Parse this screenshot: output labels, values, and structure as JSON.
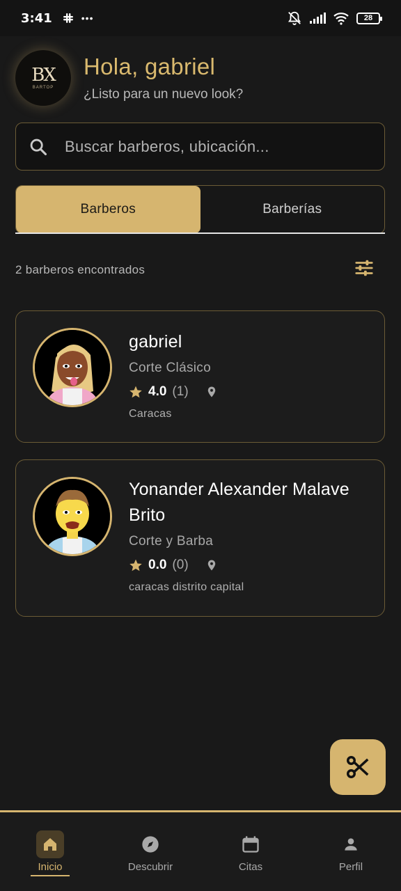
{
  "status_bar": {
    "time": "3:41",
    "extra": "•••",
    "battery": "28"
  },
  "header": {
    "logo_mark": "BX",
    "logo_sub": "BARTOP",
    "greeting": "Hola, gabriel",
    "subtitle": "¿Listo para un nuevo look?"
  },
  "search": {
    "placeholder": "Buscar barberos, ubicación..."
  },
  "tabs": [
    {
      "label": "Barberos",
      "active": true
    },
    {
      "label": "Barberías",
      "active": false
    }
  ],
  "results": {
    "count_text": "2 barberos encontrados"
  },
  "barbers": [
    {
      "name": "gabriel",
      "specialty": "Corte Clásico",
      "rating": "4.0",
      "reviews": "(1)",
      "location": "Caracas"
    },
    {
      "name": "Yonander Alexander Malave Brito",
      "specialty": "Corte y Barba",
      "rating": "0.0",
      "reviews": "(0)",
      "location": "caracas distrito capital"
    }
  ],
  "bottom_nav": [
    {
      "label": "Inicio",
      "icon": "home-icon",
      "active": true
    },
    {
      "label": "Descubrir",
      "icon": "compass-icon",
      "active": false
    },
    {
      "label": "Citas",
      "icon": "calendar-icon",
      "active": false
    },
    {
      "label": "Perfil",
      "icon": "person-icon",
      "active": false
    }
  ],
  "colors": {
    "accent": "#d6b56f",
    "background": "#191919",
    "card_border": "#6c5c36"
  }
}
